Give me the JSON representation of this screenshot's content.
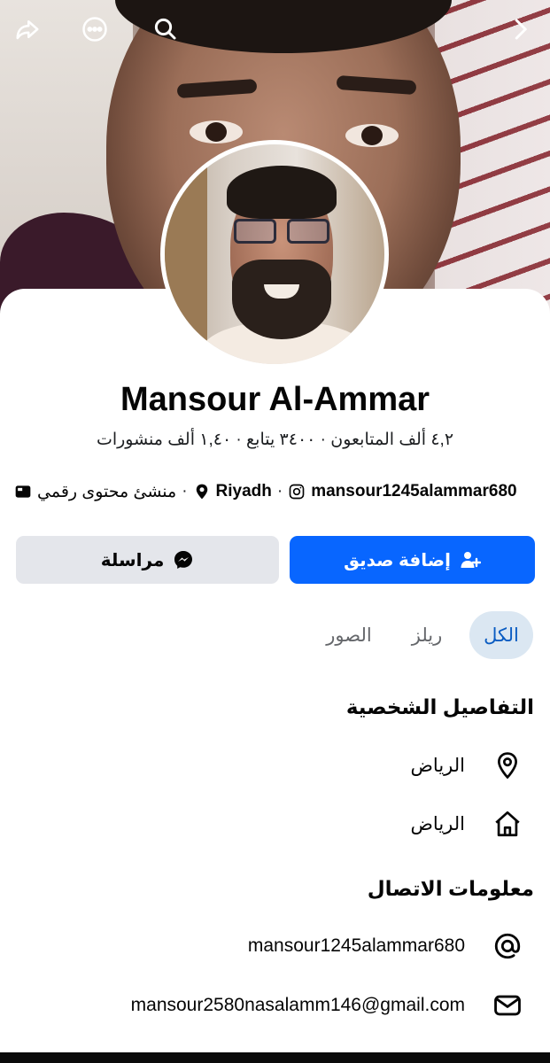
{
  "header": {
    "icons": [
      "share-icon",
      "more-options-icon",
      "search-icon",
      "chevron-right-icon"
    ]
  },
  "profile": {
    "name": "Mansour Al-Ammar",
    "stats": "٤,٢ ألف المتابعون · ٣٤٠٠ يتابع · ١,٤٠ ألف منشورات",
    "category": "منشئ محتوى رقمي",
    "location": "Riyadh",
    "instagram": "mansour1245alammar680"
  },
  "actions": {
    "add_friend": "إضافة صديق",
    "message": "مراسلة"
  },
  "tabs": {
    "all": "الكل",
    "reels": "ريلز",
    "photos": "الصور"
  },
  "details": {
    "title": "التفاصيل الشخصية",
    "current_city": "الرياض",
    "hometown": "الرياض"
  },
  "contact": {
    "title": "معلومات الاتصال",
    "username": "mansour1245alammar680",
    "email": "mansour2580nasalamm146@gmail.com"
  },
  "colors": {
    "accent": "#0866ff",
    "secondary_button": "#e4e6eb",
    "active_tab_bg": "#dbe7f2",
    "active_tab_text": "#0a5cc2"
  }
}
